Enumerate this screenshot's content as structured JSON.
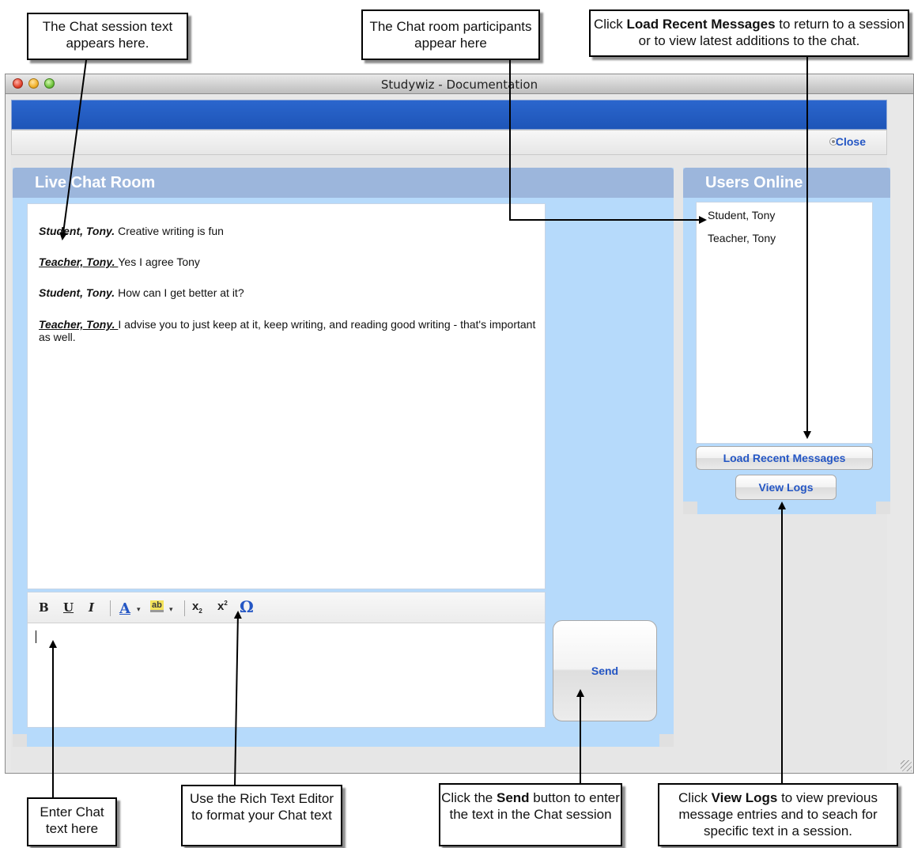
{
  "window": {
    "title": "Studywiz - Documentation"
  },
  "header": {
    "close_label": "Close"
  },
  "chat": {
    "title": "Live Chat Room",
    "messages": [
      {
        "author": "Student, Tony.",
        "text": " Creative writing is fun",
        "style": "bold-italic"
      },
      {
        "author": "Teacher, Tony. ",
        "text": " Yes I agree Tony",
        "style": "bold-italic-underline"
      },
      {
        "author": "Student, Tony.",
        "text": " How can I get better at it?",
        "style": "bold-italic"
      },
      {
        "author": "Teacher, Tony. ",
        "text": " I advise you to just keep at it, keep writing, and reading good writing - that's important as well.",
        "style": "bold-italic-underline"
      }
    ],
    "toolbar": {
      "bold": "B",
      "underline": "U",
      "italic": "I",
      "font_color": "A",
      "highlight": "ab",
      "subscript": "x",
      "superscript": "x",
      "special_char": "Ω"
    },
    "send_label": "Send"
  },
  "users": {
    "title": "Users Online",
    "list": [
      "Student, Tony",
      "Teacher, Tony"
    ],
    "load_recent_label": "Load Recent Messages",
    "view_logs_label": "View Logs"
  },
  "callouts": {
    "session_text": "The Chat session text appears here.",
    "participants": "The Chat room participants appear here",
    "load_recent_pre": "Click ",
    "load_recent_bold": "Load Recent Messages",
    "load_recent_post": " to return to a session or to view latest additions to the chat.",
    "enter_text": "Enter Chat text here",
    "rich_text": "Use the Rich Text Editor to format your Chat text",
    "send_pre": "Click the ",
    "send_bold": "Send",
    "send_post": " button to enter the text in the Chat session",
    "logs_pre": "Click ",
    "logs_bold": "View Logs",
    "logs_post": " to view previous message entries and to seach for specific text in a session."
  },
  "colors": {
    "accent_blue": "#1e55b8",
    "panel_bg": "#b6dafb",
    "panel_header": "#9cb6dc",
    "link_blue": "#2456c4"
  }
}
